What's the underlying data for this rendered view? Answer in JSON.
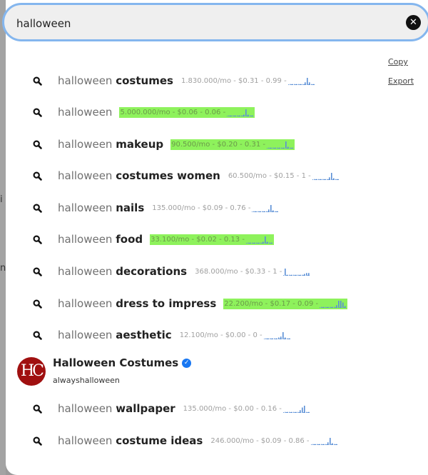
{
  "search": {
    "value": "halloween",
    "clear_icon": "close-circle-icon"
  },
  "actions": {
    "copy": "Copy",
    "export": "Export"
  },
  "colors": {
    "highlight": "#8ef25c",
    "accent": "#84b6ee",
    "spark": "#5b8fd6"
  },
  "background_fragments": [
    "i",
    "n"
  ],
  "suggestions": [
    {
      "prefix": "halloween",
      "suffix": "costumes",
      "metric": "1.830.000/mo - $0.31 - 0.99 -",
      "highlight": false,
      "trend": [
        1,
        1,
        1,
        1,
        1,
        1,
        1,
        3,
        8,
        3,
        1,
        1
      ]
    },
    {
      "prefix": "halloween",
      "suffix": "",
      "metric": "5.000.000/mo - $0.06 - 0.06 -",
      "highlight": true,
      "trend": [
        1,
        1,
        1,
        1,
        1,
        1,
        1,
        2,
        8,
        2,
        1,
        1
      ]
    },
    {
      "prefix": "halloween",
      "suffix": "makeup",
      "metric": "90.500/mo - $0.20 - 0.31 -",
      "highlight": true,
      "trend": [
        1,
        1,
        1,
        1,
        1,
        1,
        1,
        1,
        8,
        2,
        1,
        1
      ]
    },
    {
      "prefix": "halloween",
      "suffix": "costumes women",
      "metric": "60.500/mo - $0.15 - 1 -",
      "highlight": false,
      "trend": [
        1,
        1,
        1,
        1,
        1,
        1,
        1,
        3,
        8,
        2,
        1,
        1
      ]
    },
    {
      "prefix": "halloween",
      "suffix": "nails",
      "metric": "135.000/mo - $0.09 - 0.76 -",
      "highlight": false,
      "trend": [
        1,
        1,
        1,
        1,
        1,
        1,
        1,
        3,
        8,
        2,
        1,
        1
      ]
    },
    {
      "prefix": "halloween",
      "suffix": "food",
      "metric": "33.100/mo - $0.02 - 0.13 -",
      "highlight": true,
      "trend": [
        1,
        1,
        1,
        1,
        1,
        1,
        1,
        2,
        8,
        2,
        1,
        1
      ]
    },
    {
      "prefix": "halloween",
      "suffix": "decorations",
      "metric": "368.000/mo - $0.33 - 1 -",
      "highlight": false,
      "trend": [
        8,
        1,
        1,
        1,
        1,
        1,
        1,
        1,
        1,
        2,
        3,
        3
      ]
    },
    {
      "prefix": "halloween",
      "suffix": "dress to impress",
      "metric": "22.200/mo - $0.17 - 0.09 -",
      "highlight": true,
      "trend": [
        1,
        1,
        1,
        1,
        1,
        1,
        1,
        3,
        8,
        8,
        6,
        2
      ]
    },
    {
      "prefix": "halloween",
      "suffix": "aesthetic",
      "metric": "12.100/mo - $0.00 - 0 -",
      "highlight": false,
      "trend": [
        1,
        1,
        1,
        1,
        1,
        1,
        2,
        3,
        8,
        2,
        1,
        1
      ]
    }
  ],
  "profile": {
    "initials": "HC",
    "name": "Halloween Costumes",
    "handle": "alwayshalloween",
    "verified_icon": "verified-badge-icon"
  },
  "suggestions_after": [
    {
      "prefix": "halloween",
      "suffix": "wallpaper",
      "metric": "135.000/mo - $0.00 - 0.16 -",
      "highlight": false,
      "trend": [
        1,
        1,
        1,
        1,
        1,
        1,
        1,
        3,
        6,
        8,
        1,
        1
      ]
    },
    {
      "prefix": "halloween",
      "suffix": "costume ideas",
      "metric": "246.000/mo - $0.09 - 0.86 -",
      "highlight": false,
      "trend": [
        1,
        1,
        1,
        1,
        1,
        1,
        1,
        3,
        8,
        2,
        1,
        1
      ]
    }
  ]
}
